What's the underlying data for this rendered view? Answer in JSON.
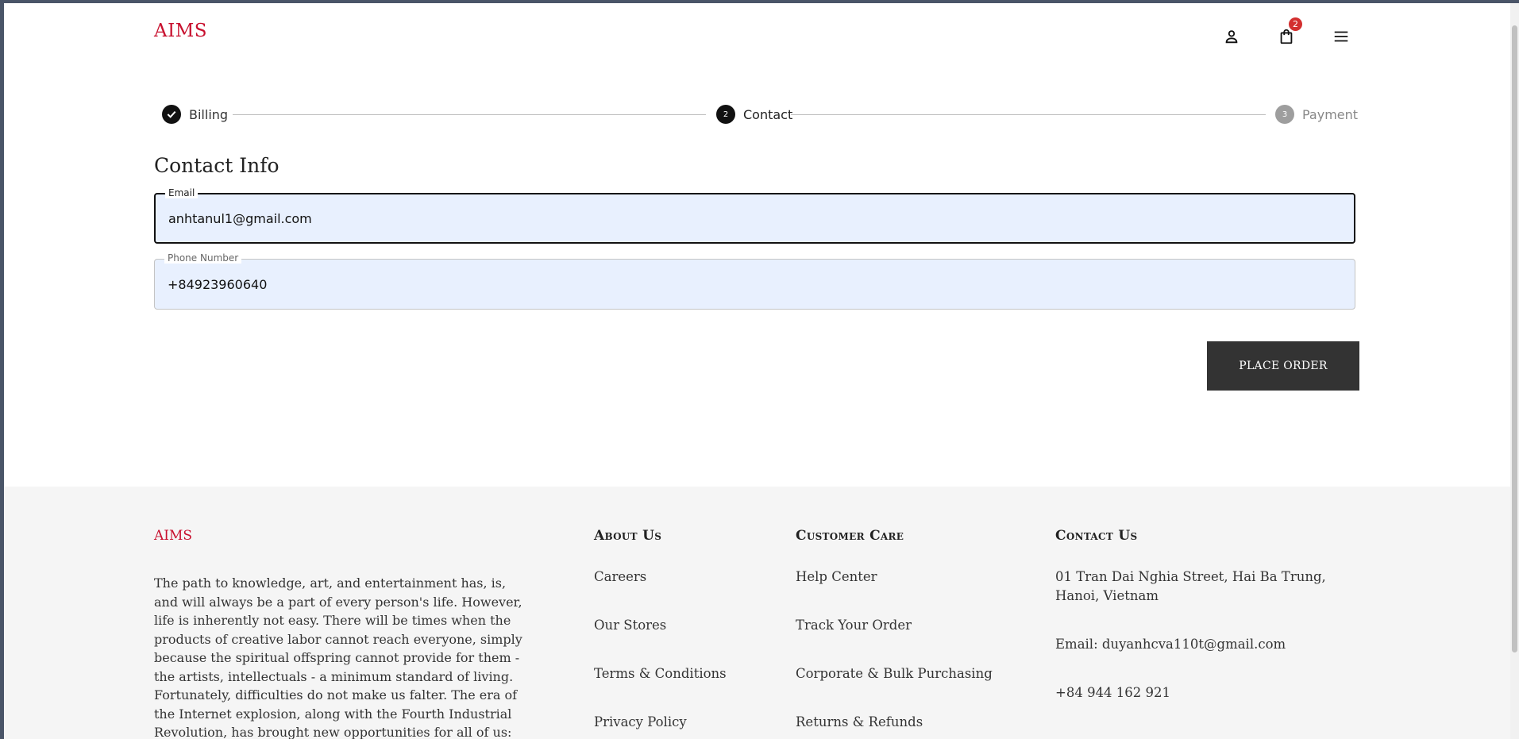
{
  "header": {
    "logo": "AIMS",
    "cart_count": "2",
    "icons": [
      "user-icon",
      "shopping-bag-icon",
      "menu-icon"
    ]
  },
  "stepper": {
    "steps": [
      {
        "label": "Billing",
        "state": "done",
        "number": ""
      },
      {
        "label": "Contact",
        "state": "active",
        "number": "2"
      },
      {
        "label": "Payment",
        "state": "pending",
        "number": "3"
      }
    ]
  },
  "form": {
    "title": "Contact Info",
    "email_label": "Email",
    "email_value": "anhtanul1@gmail.com",
    "phone_label": "Phone Number",
    "phone_value": "+84923960640",
    "submit_label": "PLACE ORDER"
  },
  "footer": {
    "logo": "AIMS",
    "about_text": "The path to knowledge, art, and entertainment has, is, and will always be a part of every person's life. However, life is inherently not easy. There will be times when the products of creative labor cannot reach everyone, simply because the spiritual offspring cannot provide for them - the artists, intellectuals - a minimum standard of living. Fortunately, difficulties do not make us falter. The era of the Internet explosion, along with the Fourth Industrial Revolution, has brought new opportunities for all of us:",
    "about_us": {
      "heading": "About Us",
      "links": [
        "Careers",
        "Our Stores",
        "Terms & Conditions",
        "Privacy Policy"
      ]
    },
    "customer_care": {
      "heading": "Customer Care",
      "links": [
        "Help Center",
        "Track Your Order",
        "Corporate & Bulk Purchasing",
        "Returns & Refunds"
      ]
    },
    "contact_us": {
      "heading": "Contact Us",
      "address": "01 Tran Dai Nghia Street, Hai Ba Trung, Hanoi, Vietnam",
      "email": "Email: duyanhcva110t@gmail.com",
      "phone": "+84 944 162 921"
    }
  },
  "colors": {
    "brand": "#c8102e",
    "button": "#333333",
    "field_bg": "#e8f0fe",
    "badge": "#d32f2f",
    "footer_bg": "#f5f5f5"
  }
}
